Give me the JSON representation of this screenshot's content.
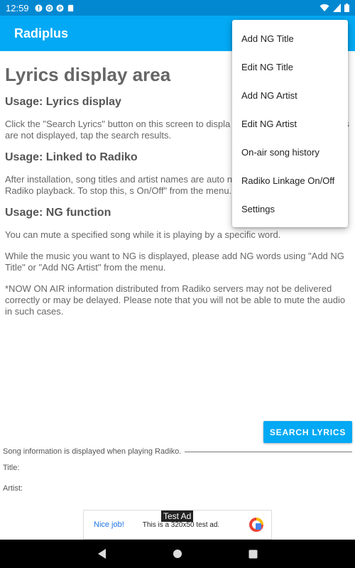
{
  "status_bar": {
    "time": "12:59",
    "left_icons": [
      "alert-icon",
      "sync-icon",
      "p-icon",
      "sd-card-icon"
    ],
    "right_icons": [
      "wifi-icon",
      "cell-signal-icon",
      "battery-icon"
    ]
  },
  "app_bar": {
    "title": "Radiplus"
  },
  "content": {
    "heading": "Lyrics display area",
    "sections": [
      {
        "title": "Usage: Lyrics display",
        "paragraphs": [
          "Click the \"Search Lyrics\" button on this screen to displa currently playing. If the lyrics are not displayed, tap the search results."
        ]
      },
      {
        "title": "Usage: Linked to Radiko",
        "paragraphs": [
          "After installation, song titles and artist names are auto notification area during Radiko playback. To stop this, s On/Off\" from the menu."
        ]
      },
      {
        "title": "Usage: NG function",
        "paragraphs": [
          "You can mute a specified song while it is playing by a specific word.",
          "While the music you want to NG is displayed, please add NG words using \"Add NG Title\" or \"Add NG Artist\" from the menu.",
          "*NOW ON AIR information distributed from Radiko servers may not be delivered correctly or may be delayed. Please note that you will not be able to mute the audio in such cases."
        ]
      }
    ]
  },
  "menu": {
    "items": [
      "Add NG Title",
      "Edit NG Title",
      "Add NG Artist",
      "Edit NG Artist",
      "On-air song history",
      "Radiko Linkage On/Off",
      "Settings"
    ]
  },
  "search_button": {
    "label": "SEARCH LYRICS"
  },
  "song_info": {
    "caption": "Song information is displayed when playing Radiko.",
    "title_label": "Title:",
    "artist_label": "Artist:"
  },
  "ad": {
    "label": "Test Ad",
    "nice": "Nice job!",
    "text": "This is a 320x50 test ad."
  },
  "nav_bar": {
    "icons": [
      "back-icon",
      "home-icon",
      "recents-icon"
    ]
  },
  "colors": {
    "status_bar": "#0288d1",
    "app_bar": "#03a9f4",
    "accent": "#03a9f4"
  }
}
